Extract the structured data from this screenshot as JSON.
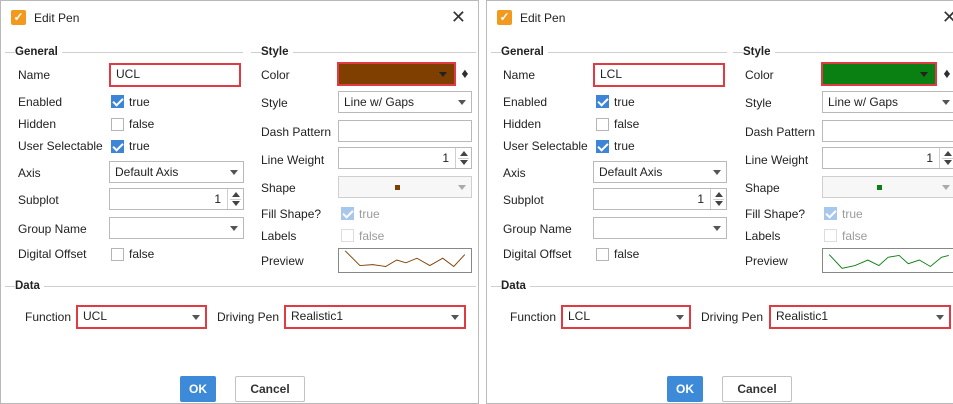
{
  "dialogs": [
    {
      "title": "Edit Pen",
      "sections": {
        "general": "General",
        "style": "Style",
        "data": "Data"
      },
      "labels": {
        "name": "Name",
        "enabled": "Enabled",
        "hidden": "Hidden",
        "user_selectable": "User Selectable",
        "axis": "Axis",
        "subplot": "Subplot",
        "group_name": "Group Name",
        "digital_offset": "Digital Offset",
        "color": "Color",
        "style": "Style",
        "dash_pattern": "Dash Pattern",
        "line_weight": "Line Weight",
        "shape": "Shape",
        "fill_shape": "Fill Shape?",
        "labels": "Labels",
        "preview": "Preview",
        "function": "Function",
        "driving_pen": "Driving Pen"
      },
      "values": {
        "name": "UCL",
        "enabled": "true",
        "hidden": "false",
        "user_selectable": "true",
        "axis": "Default Axis",
        "subplot": "1",
        "group_name": "",
        "digital_offset": "false",
        "color": "#7f3f00",
        "style": "Line w/ Gaps",
        "dash_pattern": "",
        "line_weight": "1",
        "fill_shape": "true",
        "labels": "false",
        "function": "UCL",
        "driving_pen": "Realistic1"
      },
      "buttons": {
        "ok": "OK",
        "cancel": "Cancel"
      }
    },
    {
      "title": "Edit Pen",
      "sections": {
        "general": "General",
        "style": "Style",
        "data": "Data"
      },
      "labels": {
        "name": "Name",
        "enabled": "Enabled",
        "hidden": "Hidden",
        "user_selectable": "User Selectable",
        "axis": "Axis",
        "subplot": "Subplot",
        "group_name": "Group Name",
        "digital_offset": "Digital Offset",
        "color": "Color",
        "style": "Style",
        "dash_pattern": "Dash Pattern",
        "line_weight": "Line Weight",
        "shape": "Shape",
        "fill_shape": "Fill Shape?",
        "labels": "Labels",
        "preview": "Preview",
        "function": "Function",
        "driving_pen": "Driving Pen"
      },
      "values": {
        "name": "LCL",
        "enabled": "true",
        "hidden": "false",
        "user_selectable": "true",
        "axis": "Default Axis",
        "subplot": "1",
        "group_name": "",
        "digital_offset": "false",
        "color": "#0a7f12",
        "style": "Line w/ Gaps",
        "dash_pattern": "",
        "line_weight": "1",
        "fill_shape": "true",
        "labels": "false",
        "function": "LCL",
        "driving_pen": "Realistic1"
      },
      "buttons": {
        "ok": "OK",
        "cancel": "Cancel"
      }
    }
  ],
  "theme": {
    "accent": "#3d8ad8",
    "highlight": "#e03b43",
    "app_icon": "#f19a1d"
  },
  "icons": {
    "app": "edit-pen-app-icon",
    "close": "close-icon",
    "paint_bucket": "paint-bucket-icon",
    "dropdown": "chevron-down-icon",
    "spinner": "spinner-arrows-icon",
    "checkbox": "check-icon"
  }
}
